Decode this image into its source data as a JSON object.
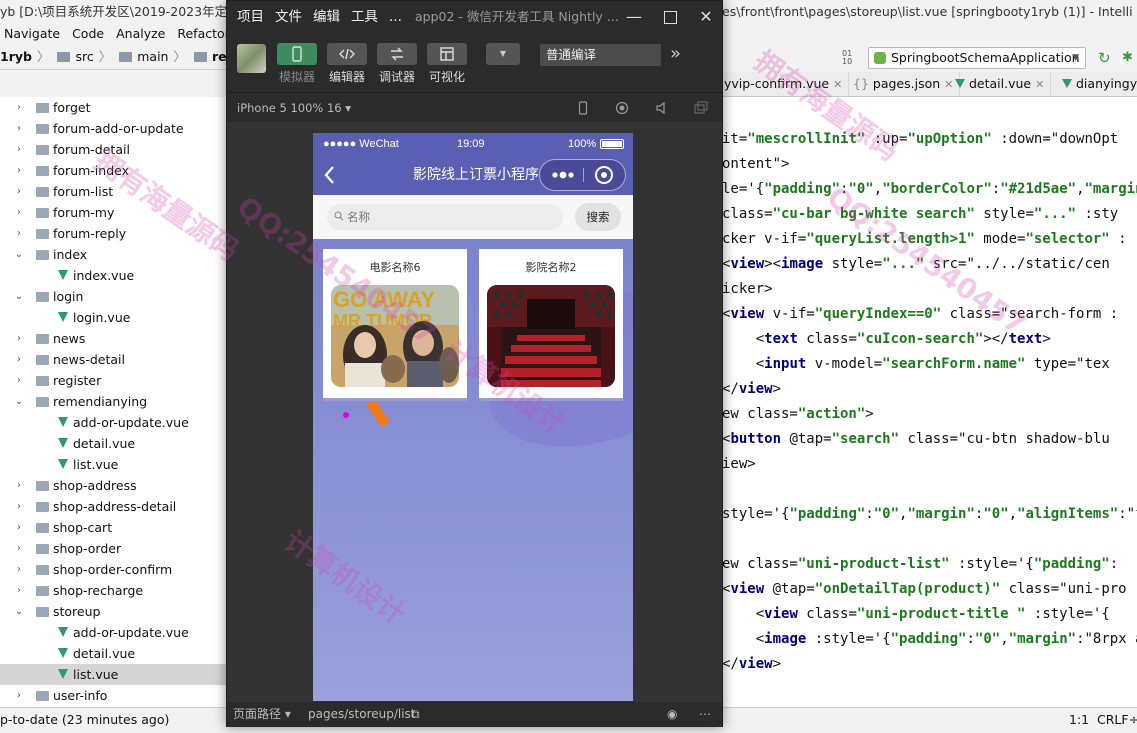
{
  "ide": {
    "title_left": "yb [D:\\项目系统开发区\\2019-2023年定做",
    "title_right": "es\\front\\front\\pages\\storeup\\list.vue [springbooty1ryb (1)] - Intelli",
    "menu": [
      "Navigate",
      "Code",
      "Analyze",
      "Refactor"
    ],
    "breadcrumb": {
      "root": "1ryb",
      "src": "src",
      "main": "main",
      "resources": "resources"
    },
    "run_config": "SpringbootSchemaApplication",
    "tabs": [
      "yvip-confirm.vue",
      "pages.json",
      "detail.vue",
      "dianyingyu"
    ],
    "tree": [
      {
        "label": "forget",
        "type": "folder",
        "open": false,
        "level": 1
      },
      {
        "label": "forum-add-or-update",
        "type": "folder",
        "open": false,
        "level": 1
      },
      {
        "label": "forum-detail",
        "type": "folder",
        "open": false,
        "level": 1
      },
      {
        "label": "forum-index",
        "type": "folder",
        "open": false,
        "level": 1
      },
      {
        "label": "forum-list",
        "type": "folder",
        "open": false,
        "level": 1
      },
      {
        "label": "forum-my",
        "type": "folder",
        "open": false,
        "level": 1
      },
      {
        "label": "forum-reply",
        "type": "folder",
        "open": false,
        "level": 1
      },
      {
        "label": "index",
        "type": "folder",
        "open": true,
        "level": 1
      },
      {
        "label": "index.vue",
        "type": "vue",
        "level": 2
      },
      {
        "label": "login",
        "type": "folder",
        "open": true,
        "level": 1
      },
      {
        "label": "login.vue",
        "type": "vue",
        "level": 2
      },
      {
        "label": "news",
        "type": "folder",
        "open": false,
        "level": 1
      },
      {
        "label": "news-detail",
        "type": "folder",
        "open": false,
        "level": 1
      },
      {
        "label": "register",
        "type": "folder",
        "open": false,
        "level": 1
      },
      {
        "label": "remendianying",
        "type": "folder",
        "open": true,
        "level": 1
      },
      {
        "label": "add-or-update.vue",
        "type": "vue",
        "level": 2
      },
      {
        "label": "detail.vue",
        "type": "vue",
        "level": 2
      },
      {
        "label": "list.vue",
        "type": "vue",
        "level": 2
      },
      {
        "label": "shop-address",
        "type": "folder",
        "open": false,
        "level": 1
      },
      {
        "label": "shop-address-detail",
        "type": "folder",
        "open": false,
        "level": 1
      },
      {
        "label": "shop-cart",
        "type": "folder",
        "open": false,
        "level": 1
      },
      {
        "label": "shop-order",
        "type": "folder",
        "open": false,
        "level": 1
      },
      {
        "label": "shop-order-confirm",
        "type": "folder",
        "open": false,
        "level": 1
      },
      {
        "label": "shop-recharge",
        "type": "folder",
        "open": false,
        "level": 1
      },
      {
        "label": "storeup",
        "type": "folder",
        "open": true,
        "level": 1
      },
      {
        "label": "add-or-update.vue",
        "type": "vue",
        "level": 2
      },
      {
        "label": "detail.vue",
        "type": "vue",
        "level": 2
      },
      {
        "label": "list.vue",
        "type": "vue",
        "level": 2,
        "selected": true
      },
      {
        "label": "user-info",
        "type": "folder",
        "open": false,
        "level": 1
      }
    ],
    "status_left": "p-to-date (23 minutes ago)",
    "status_pos": "1:1",
    "status_enc": "CRLF÷",
    "code": [
      "it=\"mescrollInit\" :up=\"upOption\" :down=\"downOpt",
      "ontent\">",
      "le='{\"padding\":\"0\",\"borderColor\":\"#21d5ae\",\"margin\":",
      "class=\"cu-bar bg-white search\" style=\"...\" :sty",
      "cker v-if=\"queryList.length>1\" mode=\"selector\" :",
      "<view><image style=\"...\" src=\"../../static/cen",
      "icker>",
      "<view v-if=\"queryIndex==0\" class=\"search-form :",
      "    <text class=\"cuIcon-search\"></text>",
      "    <input v-model=\"searchForm.name\" type=\"tex",
      "</view>",
      "ew class=\"action\">",
      "<button @tap=\"search\" class=\"cu-btn shadow-blu",
      "iew>",
      "",
      "style='{\"padding\":\"0\",\"margin\":\"0\",\"alignItems\":\"fl",
      "",
      "ew class=\"uni-product-list\" :style='{\"padding\":",
      "<view @tap=\"onDetailTap(product)\" class=\"uni-pro",
      "    <view class=\"uni-product-title \" :style='{",
      "    <image :style='{\"padding\":\"0\",\"margin\":\"8rpx a",
      "</view>"
    ]
  },
  "devtools": {
    "menu": [
      "项目",
      "文件",
      "编辑",
      "工具",
      "..."
    ],
    "app_title": "app02 - 微信开发者工具 Nightly ...",
    "toolbar": [
      {
        "label": "模拟器",
        "active": true
      },
      {
        "label": "编辑器",
        "active": false
      },
      {
        "label": "调试器",
        "active": false
      },
      {
        "label": "可视化",
        "active": false
      }
    ],
    "compile_mode": "普通编译",
    "device": "iPhone 5 100% 16 ▾",
    "footer_label": "页面路径 ▾",
    "footer_path": "pages/storeup/list"
  },
  "phone": {
    "carrier": "●●●●● WeChat",
    "time": "19:09",
    "battery": "100%",
    "title": "影院线上订票小程序",
    "search_placeholder": "名称",
    "search_button": "搜索",
    "cards": [
      {
        "title": "电影名称6"
      },
      {
        "title": "影院名称2"
      }
    ]
  },
  "watermarks": [
    "拥有海量源码",
    "QQ:254540457",
    "计算机设计",
    "拥有海量源码",
    "QQ:254540457",
    "计算机设计"
  ]
}
